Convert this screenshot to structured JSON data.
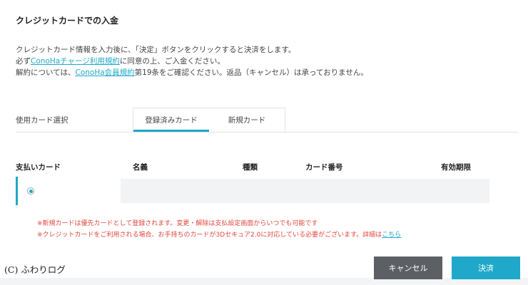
{
  "page": {
    "title": "クレジットカードでの入金"
  },
  "description": {
    "line1": "クレジットカード情報を入力後に、「決定」ボタンをクリックすると決済をします。",
    "line2_before": "必ず",
    "line2_link": "ConoHaチャージ利用規約",
    "line2_after": "に同意の上、ご入金ください。",
    "line3_before": "解約については、",
    "line3_link": "ConoHa会員規約",
    "line3_after": "第19条をご確認ください。返品（キャンセル）は承っておりません。"
  },
  "card_select": {
    "label": "使用カード選択",
    "tabs": [
      {
        "label": "登録済みカード",
        "active": true
      },
      {
        "label": "新規カード",
        "active": false
      }
    ]
  },
  "table": {
    "headers": {
      "payment_card": "支払いカード",
      "name": "名義",
      "type": "種類",
      "card_number": "カード番号",
      "expiry": "有効期限"
    },
    "rows": [
      {
        "selected": true,
        "name": "",
        "type": "",
        "card_number": "",
        "expiry": ""
      }
    ]
  },
  "notes": {
    "note1": "※新規カードは優先カードとして登録されます。変更・解除は支払設定画面からいつでも可能です",
    "note2_before": "※クレジットカードをご利用される場合、お手持ちのカードが3Dセキュア2.0に対応している必要がございます。詳細は",
    "note2_link": "こちら"
  },
  "watermark": "(C) ふわりログ",
  "buttons": {
    "cancel": "キャンセル",
    "submit": "決済"
  },
  "colors": {
    "accent": "#1fa8c9",
    "cancel_button": "#5c6064",
    "note_text": "#e0463d"
  }
}
